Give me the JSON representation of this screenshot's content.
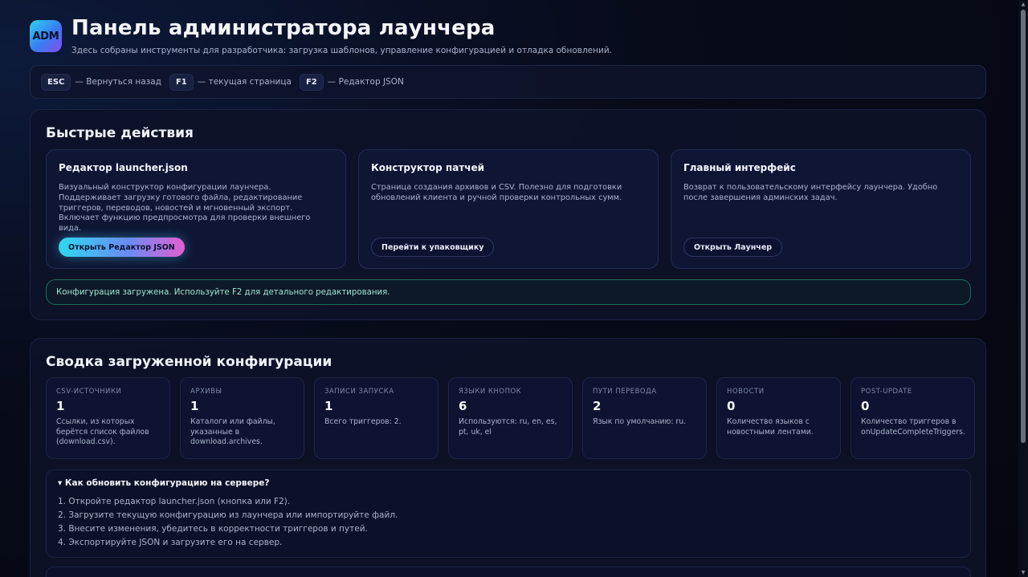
{
  "header": {
    "logo_text": "ADM",
    "title": "Панель администратора лаунчера",
    "subtitle": "Здесь собраны инструменты для разработчика: загрузка шаблонов, управление конфигурацией и отладка обновлений."
  },
  "hotkeys": [
    {
      "key": "ESC",
      "desc": "— Вернуться назад"
    },
    {
      "key": "F1",
      "desc": "— текущая страница"
    },
    {
      "key": "F2",
      "desc": "— Редактор JSON"
    }
  ],
  "quick_actions": {
    "title": "Быстрые действия",
    "cards": [
      {
        "title": "Редактор launcher.json",
        "text": "Визуальный конструктор конфигурации лаунчера. Поддерживает загрузку готового файла, редактирование триггеров, переводов, новостей и мгновенный экспорт. Включает функцию предпросмотра для проверки внешнего вида.",
        "button": "Открыть Редактор JSON"
      },
      {
        "title": "Конструктор патчей",
        "text": "Страница создания архивов и CSV. Полезно для подготовки обновлений клиента и ручной проверки контрольных сумм.",
        "button": "Перейти к упаковщику"
      },
      {
        "title": "Главный интерфейс",
        "text": "Возврат к пользовательскому интерфейсу лаунчера. Удобно после завершения админских задач.",
        "button": "Открыть Лаунчер"
      }
    ],
    "status": "Конфигурация загружена. Используйте F2 для детального редактирования."
  },
  "summary": {
    "title": "Сводка загруженной конфигурации",
    "stats": [
      {
        "label": "CSV-ИСТОЧНИКИ",
        "value": "1",
        "desc": "Ссылки, из которых берётся список файлов (download.csv)."
      },
      {
        "label": "АРХИВЫ",
        "value": "1",
        "desc": "Каталоги или файлы, указанные в download.archives."
      },
      {
        "label": "ЗАПИСИ ЗАПУСКА",
        "value": "1",
        "desc": "Всего триггеров: 2."
      },
      {
        "label": "ЯЗЫКИ КНОПОК",
        "value": "6",
        "desc": "Используются: ru, en, es, pt, uk, el"
      },
      {
        "label": "ПУТИ ПЕРЕВОДА",
        "value": "2",
        "desc": "Язык по умолчанию: ru."
      },
      {
        "label": "НОВОСТИ",
        "value": "0",
        "desc": "Количество языков с новостными лентами."
      },
      {
        "label": "POST-UPDATE",
        "value": "0",
        "desc": "Количество триггеров в onUpdateCompleteTriggers."
      }
    ],
    "faq_question": "▾ Как обновить конфигурацию на сервере?",
    "faq_steps": [
      "1. Откройте редактор launcher.json (кнопка или F2).",
      "2. Загрузите текущую конфигурацию из лаунчера или импортируйте файл.",
      "3. Внесите изменения, убедитесь в корректности триггеров и путей.",
      "4. Экспортируйте JSON и загрузите его на сервер."
    ]
  }
}
